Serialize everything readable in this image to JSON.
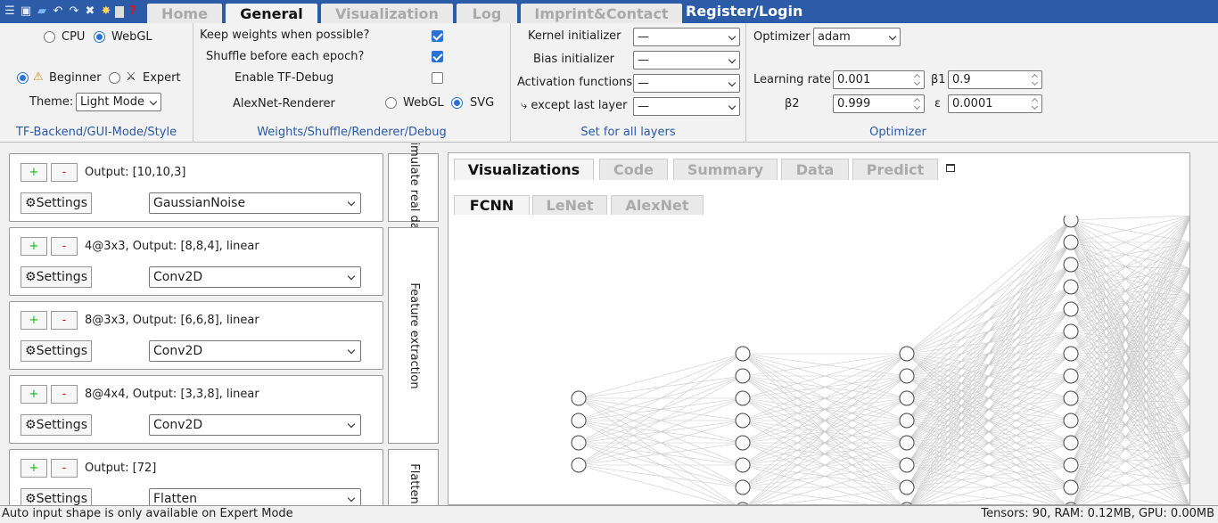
{
  "nav": {
    "tabs": [
      {
        "label": "Home",
        "active": false
      },
      {
        "label": "General",
        "active": true
      },
      {
        "label": "Visualization",
        "active": false
      },
      {
        "label": "Log",
        "active": false
      },
      {
        "label": "Imprint&Contact",
        "active": false
      }
    ],
    "register_login": "Register/Login"
  },
  "toolbar_icons": [
    "menu-icon",
    "save-icon",
    "open-folder-icon",
    "undo-icon",
    "redo-icon",
    "delete-icon",
    "magic-icon",
    "calculator-icon",
    "help-icon"
  ],
  "backend": {
    "cpu_label": "CPU",
    "webgl_label": "WebGL",
    "selected": "WebGL",
    "beginner_label": "Beginner",
    "expert_label": "Expert",
    "mode_selected": "Beginner",
    "theme_label": "Theme:",
    "theme_value": "Light Mode",
    "section_title": "TF-Backend/GUI-Mode/Style"
  },
  "weights": {
    "keep_weights_label": "Keep weights when possible?",
    "keep_weights": true,
    "shuffle_label": "Shuffle before each epoch?",
    "shuffle": true,
    "tf_debug_label": "Enable TF-Debug",
    "tf_debug": false,
    "renderer_label": "AlexNet-Renderer",
    "renderer_webgl": "WebGL",
    "renderer_svg": "SVG",
    "renderer_selected": "SVG",
    "section_title": "Weights/Shuffle/Renderer/Debug"
  },
  "all_layers": {
    "kernel_label": "Kernel initializer",
    "kernel_value": "—",
    "bias_label": "Bias initializer",
    "bias_value": "—",
    "activation_label": "Activation functions",
    "activation_value": "—",
    "except_last_label": "⤷ except last layer",
    "except_last_value": "—",
    "section_title": "Set for all layers"
  },
  "optimizer": {
    "label": "Optimizer",
    "value": "adam",
    "lr_label": "Learning rate",
    "lr_value": "0.001",
    "beta1_label": "β1",
    "beta1_value": "0.9",
    "beta2_label": "β2",
    "beta2_value": "0.999",
    "epsilon_label": "ε",
    "epsilon_value": "0.0001",
    "section_title": "Optimizer"
  },
  "layers": [
    {
      "info": "Output:  [10,10,3]",
      "type": "GaussianNoise",
      "settings_label": "Settings"
    },
    {
      "info": "4@3x3,  Output:  [8,8,4], linear",
      "type": "Conv2D",
      "settings_label": "Settings"
    },
    {
      "info": "8@3x3,  Output:  [6,6,8], linear",
      "type": "Conv2D",
      "settings_label": "Settings"
    },
    {
      "info": "8@4x4,  Output:  [3,3,8], linear",
      "type": "Conv2D",
      "settings_label": "Settings"
    },
    {
      "info": "Output:  [72]",
      "type": "Flatten",
      "settings_label": "Settings"
    }
  ],
  "layer_buttons": {
    "plus": "+",
    "minus": "-"
  },
  "groups": [
    "Simulate real data",
    "Feature extraction",
    "Flatten"
  ],
  "viz": {
    "tabs": [
      {
        "label": "Visualizations",
        "active": true
      },
      {
        "label": "Code",
        "active": false
      },
      {
        "label": "Summary",
        "active": false
      },
      {
        "label": "Data",
        "active": false
      },
      {
        "label": "Predict",
        "active": false
      }
    ],
    "subtabs": [
      {
        "label": "FCNN",
        "active": true
      },
      {
        "label": "LeNet",
        "active": false
      },
      {
        "label": "AlexNet",
        "active": false
      }
    ]
  },
  "status": {
    "left": "Auto input shape is only available on Expert Mode",
    "right": "Tensors: 90, RAM: 0.12MB, GPU: 0.00MB"
  },
  "colors": {
    "topbar": "#2c5ca8",
    "accent": "#2a73d4",
    "section_title": "#2a5aa8",
    "plus": "#19b619",
    "minus": "#dd1111"
  }
}
